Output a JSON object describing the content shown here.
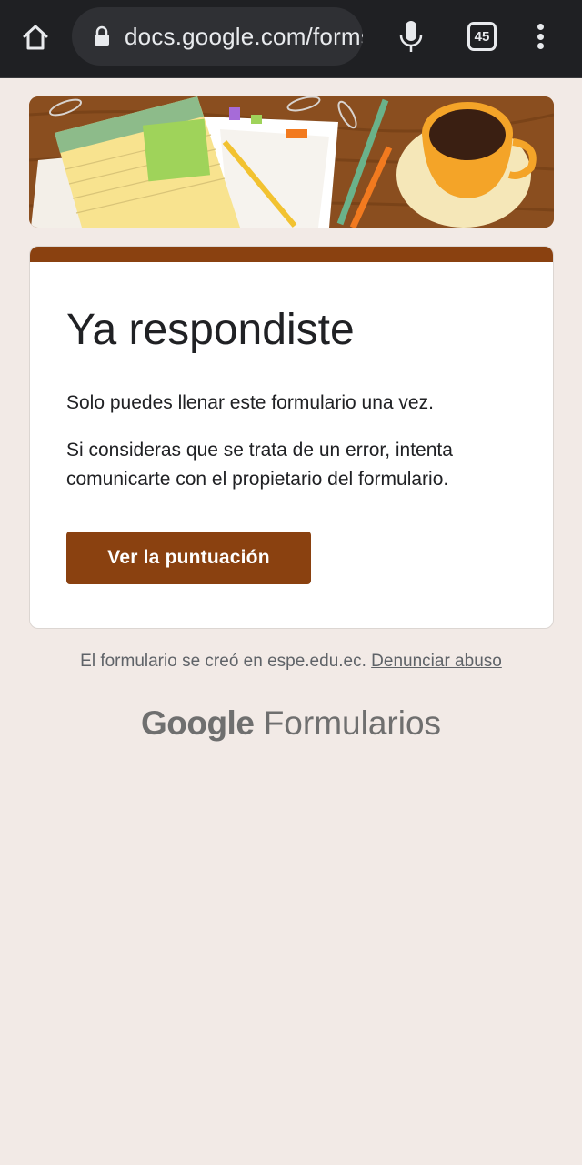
{
  "browser": {
    "url": "docs.google.com/forms",
    "tab_count": "45"
  },
  "card": {
    "title": "Ya respondiste",
    "message_1": "Solo puedes llenar este formulario una vez.",
    "message_2": "Si consideras que se trata de un error, intenta comunicarte con el propietario del formulario.",
    "button_label": "Ver la puntuación"
  },
  "footer": {
    "created_text": "El formulario se creó en espe.edu.ec.",
    "report_link": "Denunciar abuso"
  },
  "brand": {
    "google": "Google",
    "product": "Formularios"
  },
  "colors": {
    "accent": "#8a4110",
    "background": "#f2eae6"
  },
  "icons": [
    "home-icon",
    "lock-icon",
    "mic-icon",
    "tabs-icon",
    "menu-icon"
  ]
}
